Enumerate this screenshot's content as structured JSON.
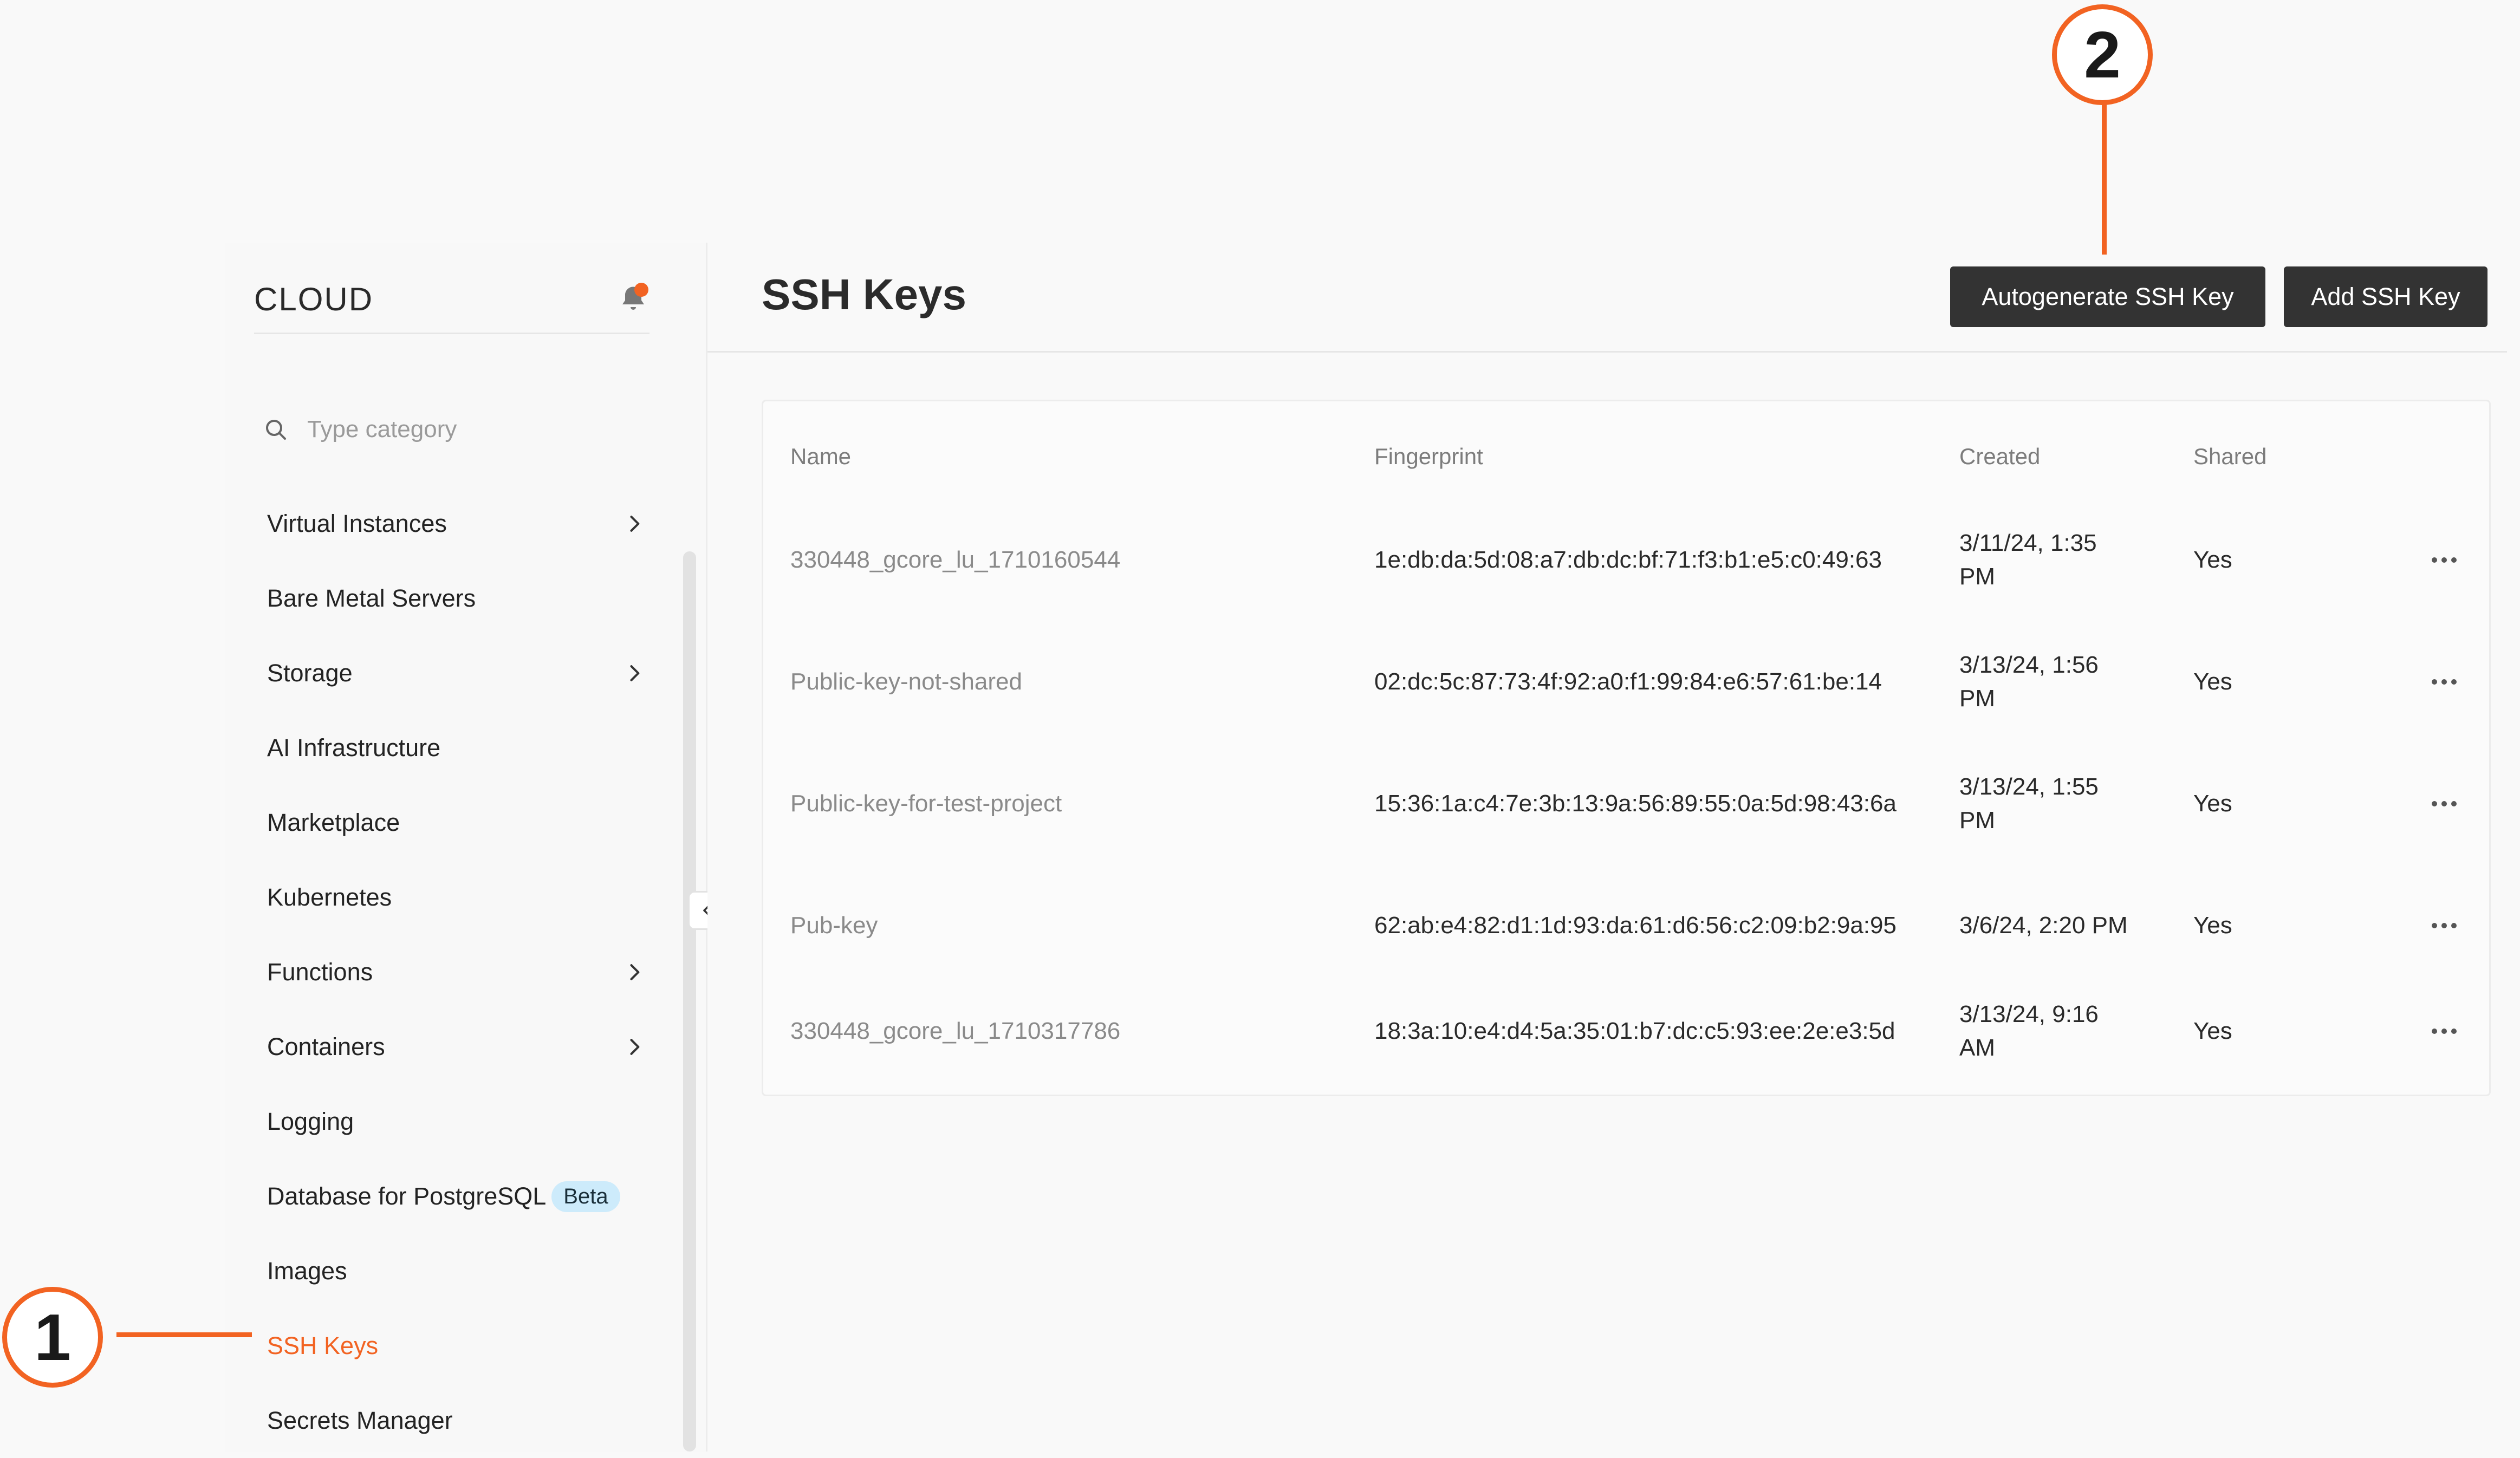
{
  "sidebar": {
    "title": "CLOUD",
    "search_placeholder": "Type category",
    "items": [
      {
        "label": "Virtual Instances",
        "chevron": true
      },
      {
        "label": "Bare Metal Servers",
        "chevron": false
      },
      {
        "label": "Storage",
        "chevron": true
      },
      {
        "label": "AI Infrastructure",
        "chevron": false
      },
      {
        "label": "Marketplace",
        "chevron": false
      },
      {
        "label": "Kubernetes",
        "chevron": false
      },
      {
        "label": "Functions",
        "chevron": true
      },
      {
        "label": "Containers",
        "chevron": true
      },
      {
        "label": "Logging",
        "chevron": false
      },
      {
        "label": "Database for PostgreSQL",
        "badge": "Beta",
        "chevron": false
      },
      {
        "label": "Images",
        "chevron": false
      },
      {
        "label": "SSH Keys",
        "chevron": false,
        "active": true
      },
      {
        "label": "Secrets Manager",
        "chevron": false
      }
    ]
  },
  "main": {
    "title": "SSH Keys",
    "autogenerate_label": "Autogenerate SSH Key",
    "add_label": "Add SSH Key",
    "table": {
      "headers": {
        "name": "Name",
        "fingerprint": "Fingerprint",
        "created": "Created",
        "shared": "Shared"
      },
      "rows": [
        {
          "name": "330448_gcore_lu_1710160544",
          "fingerprint": "1e:db:da:5d:08:a7:db:dc:bf:71:f3:b1:e5:c0:49:63",
          "created": "3/11/24, 1:35 PM",
          "shared": "Yes"
        },
        {
          "name": "Public-key-not-shared",
          "fingerprint": "02:dc:5c:87:73:4f:92:a0:f1:99:84:e6:57:61:be:14",
          "created": "3/13/24, 1:56 PM",
          "shared": "Yes"
        },
        {
          "name": "Public-key-for-test-project",
          "fingerprint": "15:36:1a:c4:7e:3b:13:9a:56:89:55:0a:5d:98:43:6a",
          "created": "3/13/24, 1:55 PM",
          "shared": "Yes"
        },
        {
          "name": "Pub-key",
          "fingerprint": "62:ab:e4:82:d1:1d:93:da:61:d6:56:c2:09:b2:9a:95",
          "created": "3/6/24, 2:20 PM",
          "shared": "Yes"
        },
        {
          "name": "330448_gcore_lu_1710317786",
          "fingerprint": "18:3a:10:e4:d4:5a:35:01:b7:dc:c5:93:ee:2e:e3:5d",
          "created": "3/13/24, 9:16 AM",
          "shared": "Yes"
        }
      ]
    }
  },
  "callouts": {
    "one": "1",
    "two": "2"
  },
  "colors": {
    "accent": "#f26322",
    "button": "#333333",
    "badge_bg": "#cdebfb"
  },
  "icons": [
    "bell-icon",
    "search-icon",
    "chevron-right-icon",
    "chevron-left-icon",
    "more-icon"
  ]
}
